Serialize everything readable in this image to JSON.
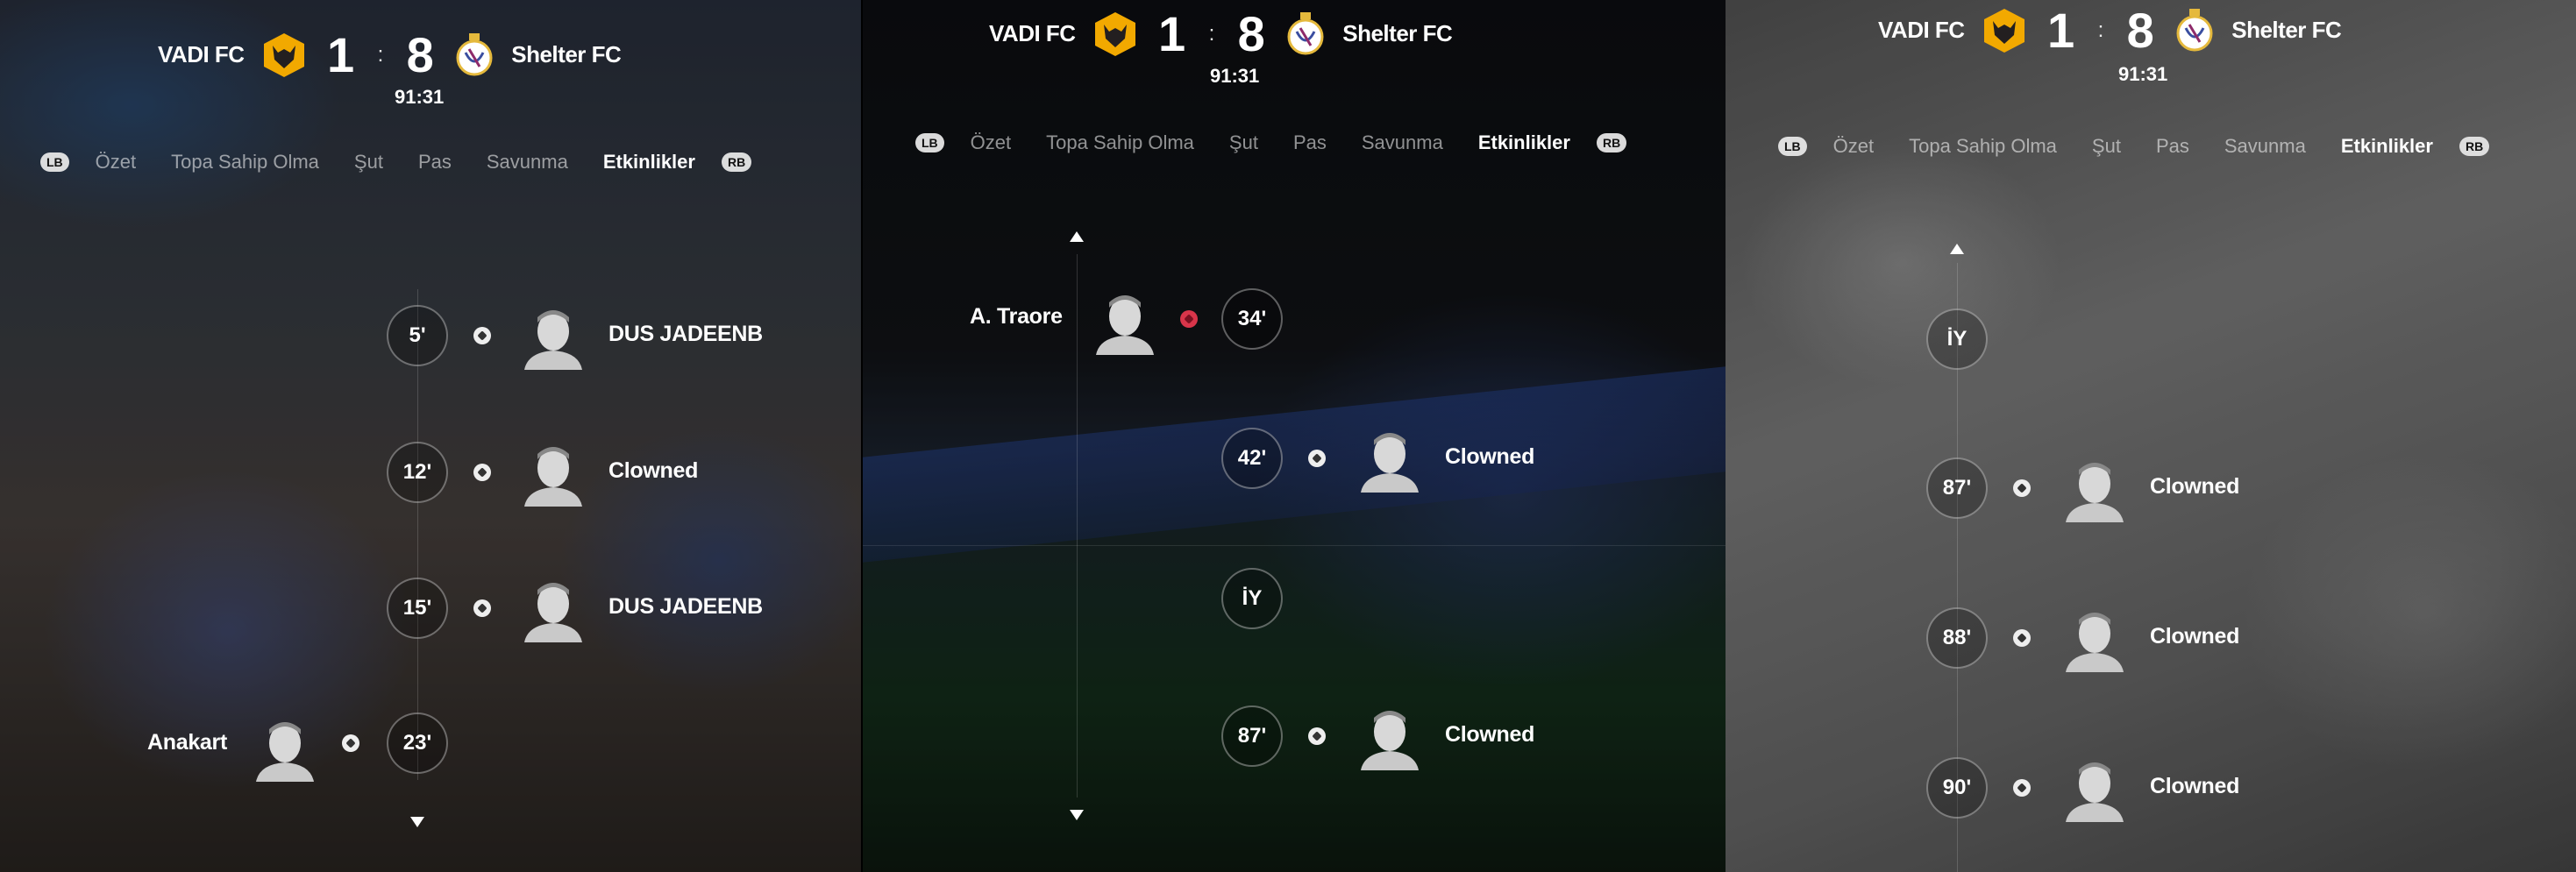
{
  "panels": [
    {
      "home_team": "VADI FC",
      "away_team": "Shelter FC",
      "home_score": "1",
      "away_score": "8",
      "score_separator": ":",
      "clock": "91:31",
      "lb": "LB",
      "rb": "RB",
      "tabs": [
        "Özet",
        "Topa Sahip Olma",
        "Şut",
        "Pas",
        "Savunma",
        "Etkinlikler"
      ],
      "active_tab": "Etkinlikler",
      "events": [
        {
          "minute": "5'",
          "side": "away",
          "player": "DUS JADEENB",
          "icon": "ball-icon"
        },
        {
          "minute": "12'",
          "side": "away",
          "player": "Clowned",
          "icon": "ball-icon"
        },
        {
          "minute": "15'",
          "side": "away",
          "player": "DUS JADEENB",
          "icon": "ball-icon"
        },
        {
          "minute": "23'",
          "side": "home",
          "player": "Anakart",
          "icon": "ball-icon"
        }
      ]
    },
    {
      "home_team": "VADI FC",
      "away_team": "Shelter FC",
      "home_score": "1",
      "away_score": "8",
      "score_separator": ":",
      "clock": "91:31",
      "lb": "LB",
      "rb": "RB",
      "tabs": [
        "Özet",
        "Topa Sahip Olma",
        "Şut",
        "Pas",
        "Savunma",
        "Etkinlikler"
      ],
      "active_tab": "Etkinlikler",
      "events": [
        {
          "minute": "34'",
          "side": "home",
          "player": "A. Traore",
          "icon": "red-ball-icon"
        },
        {
          "minute": "42'",
          "side": "away",
          "player": "Clowned",
          "icon": "ball-icon"
        },
        {
          "minute": "İY",
          "side": "marker",
          "player": "",
          "icon": ""
        },
        {
          "minute": "87'",
          "side": "away",
          "player": "Clowned",
          "icon": "ball-icon"
        }
      ]
    },
    {
      "home_team": "VADI FC",
      "away_team": "Shelter FC",
      "home_score": "1",
      "away_score": "8",
      "score_separator": ":",
      "clock": "91:31",
      "lb": "LB",
      "rb": "RB",
      "tabs": [
        "Özet",
        "Topa Sahip Olma",
        "Şut",
        "Pas",
        "Savunma",
        "Etkinlikler"
      ],
      "active_tab": "Etkinlikler",
      "events": [
        {
          "minute": "İY",
          "side": "marker",
          "player": "",
          "icon": ""
        },
        {
          "minute": "87'",
          "side": "away",
          "player": "Clowned",
          "icon": "ball-icon"
        },
        {
          "minute": "88'",
          "side": "away",
          "player": "Clowned",
          "icon": "ball-icon"
        },
        {
          "minute": "90'",
          "side": "away",
          "player": "Clowned",
          "icon": "ball-icon"
        }
      ]
    }
  ],
  "colors": {
    "wolves_badge": "#f2a900",
    "wolves_dark": "#231f20",
    "red_card_ball": "#d8354a"
  }
}
